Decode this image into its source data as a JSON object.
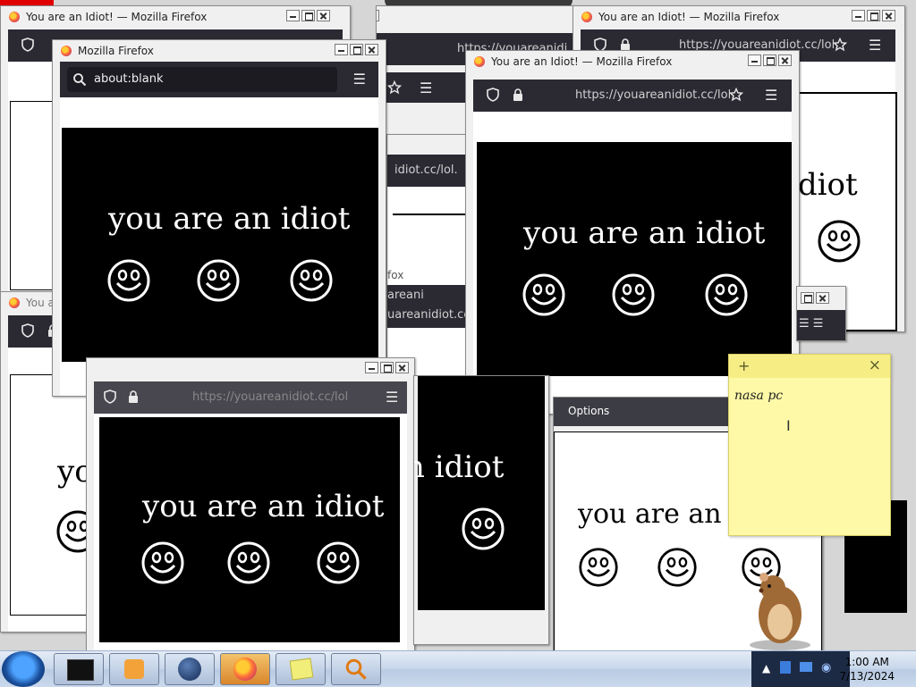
{
  "windows": {
    "title_idiot": "You are an Idiot! — Mozilla Firefox",
    "title_blank": "Mozilla Firefox",
    "title_partial": "You a",
    "title_fox": "fox",
    "url_full": "https://youareanidiot.cc/lol.",
    "url_about": "about:blank",
    "url_frag1": "https://youareanidi",
    "url_frag2": "idiot.cc/lol.",
    "url_frag3": "uareanidiot.cc",
    "url_frag4": "areani",
    "url_frag5": "https://youareanidiot.cc/lol",
    "options_label": "Options"
  },
  "content": {
    "message": "you are an idiot",
    "message_tail": "idiot",
    "message_left": "yo",
    "message_cut": "n idiot",
    "message_white_cut": "you are an i"
  },
  "sticky": {
    "text": "nasa pc",
    "add": "+",
    "close": "×"
  },
  "taskbar": {
    "apps": [
      "start-orb",
      "terminal",
      "media-player",
      "globe",
      "firefox",
      "sticky-notes",
      "search"
    ],
    "time": "1:00 AM",
    "date": "7/13/2024"
  },
  "icons": {
    "shield": "shield-icon",
    "lock": "lock-icon",
    "menu": "hamburger-menu-icon",
    "star": "bookmark-star-icon",
    "search": "search-icon",
    "smiley": "smiley-face-icon"
  },
  "colors": {
    "navbar": "#2b2a33",
    "sticky": "#fdf9a6",
    "taskbar": "#c8d7ea",
    "red_corner": "#e00000"
  }
}
